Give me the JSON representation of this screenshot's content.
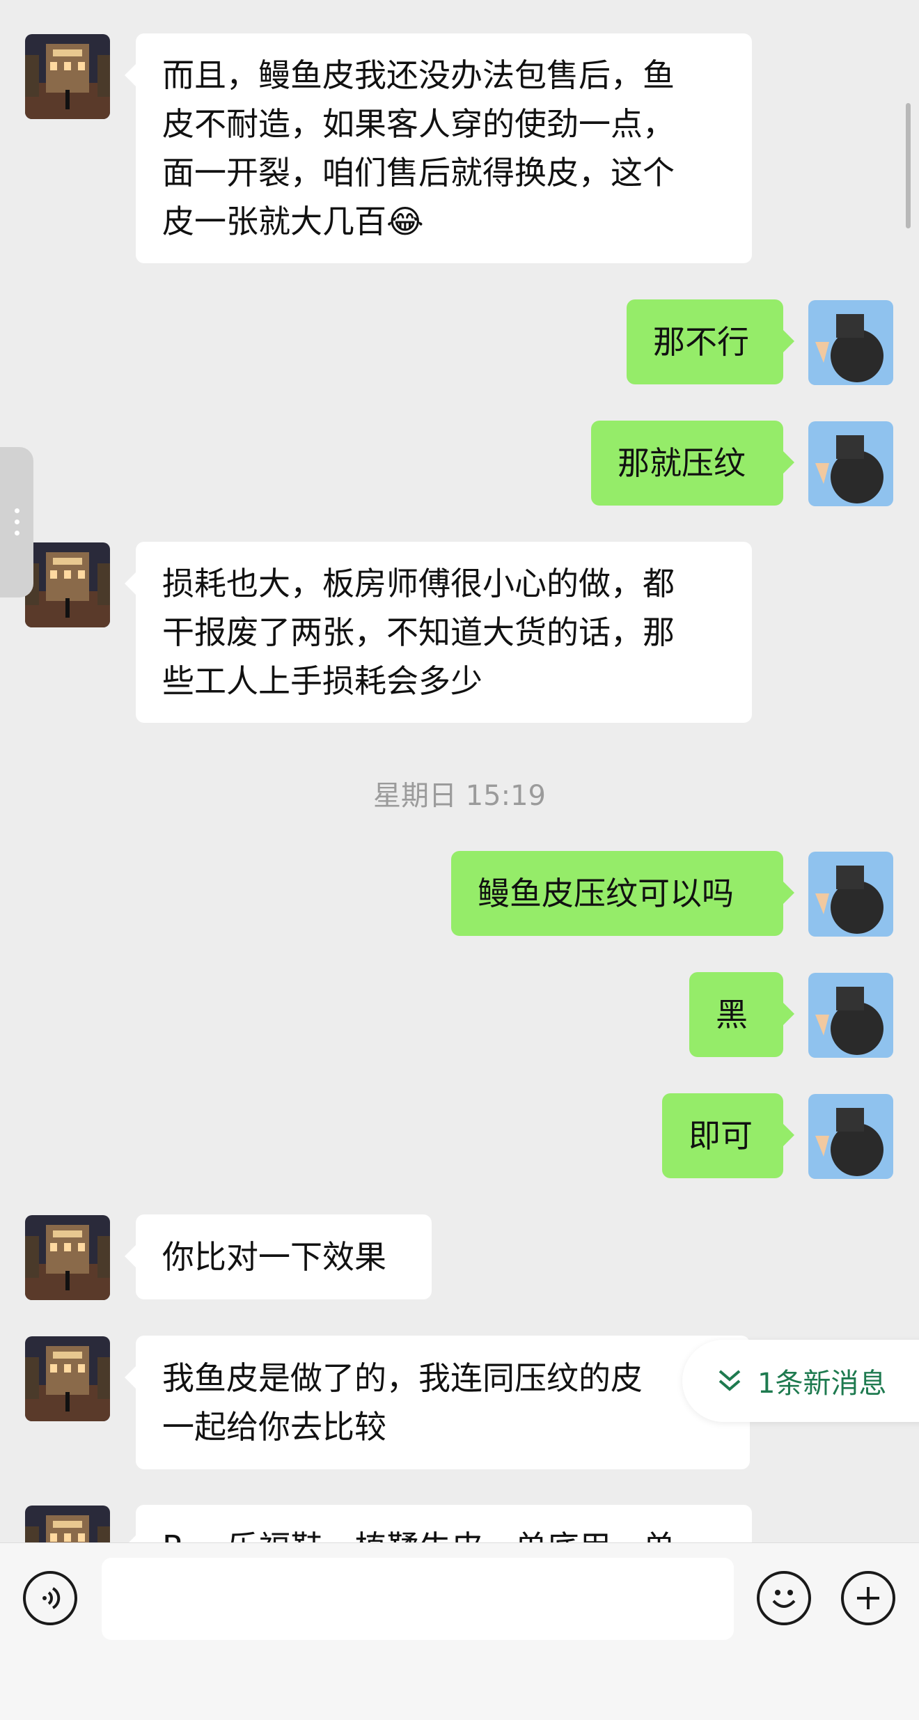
{
  "messages": [
    {
      "side": "in",
      "avatar": "city-night",
      "lines": [
        "而且，鳗鱼皮我还没办法包售后，鱼",
        "皮不耐造，如果客人穿的使劲一点，",
        "面一开裂，咱们售后就得换皮，这个",
        "皮一张就大几百😂"
      ]
    },
    {
      "side": "out",
      "avatar": "peace-sign",
      "lines": [
        "那不行"
      ]
    },
    {
      "side": "out",
      "avatar": "peace-sign",
      "lines": [
        "那就压纹"
      ]
    },
    {
      "side": "in",
      "avatar": "city-night",
      "lines": [
        "损耗也大，板房师傅很小心的做，都",
        "干报废了两张，不知道大货的话，那",
        "些工人上手损耗会多少"
      ]
    },
    {
      "side": "out",
      "avatar": "peace-sign",
      "lines": [
        "鳗鱼皮压纹可以吗"
      ]
    },
    {
      "side": "out",
      "avatar": "peace-sign",
      "lines": [
        "黑"
      ]
    },
    {
      "side": "out",
      "avatar": "peace-sign",
      "lines": [
        "即可"
      ]
    },
    {
      "side": "in",
      "avatar": "city-night",
      "lines": [
        "你比对一下效果"
      ]
    },
    {
      "side": "in",
      "avatar": "city-night",
      "lines": [
        "我鱼皮是做了的，我连同压纹的皮",
        "一起给你去比较"
      ]
    },
    {
      "side": "in",
      "avatar": "city-night",
      "lines": [
        "R… 乐福鞋，植鞣牛皮，单底用，单"
      ]
    }
  ],
  "timestamp": "星期日 15:19",
  "new_message_banner": {
    "label": "1条新消息",
    "icon": "double-chevron-down-icon"
  },
  "input_bar": {
    "voice_icon": "voice-icon",
    "emoji_icon": "emoji-icon",
    "plus_icon": "plus-icon",
    "text_value": ""
  },
  "colors": {
    "incoming": "#ffffff",
    "outgoing": "#95ec69",
    "background": "#ededed",
    "link": "#1e7a4f"
  }
}
